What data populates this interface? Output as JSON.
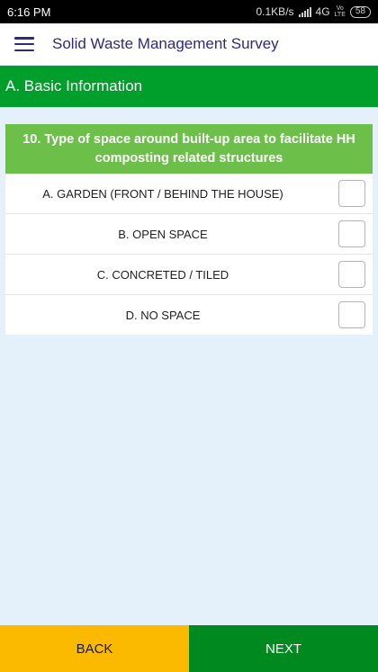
{
  "status_bar": {
    "time": "6:16 PM",
    "speed": "0.1KB/s",
    "network": "4G",
    "lte_top": "Vo",
    "lte_bottom": "LTE",
    "battery": "58"
  },
  "app_bar": {
    "title": "Solid Waste Management Survey"
  },
  "section": {
    "title": "A. Basic Information"
  },
  "question": {
    "title": "10. Type of space around built-up area to facilitate HH composting related structures",
    "options": [
      {
        "label": "A. GARDEN (FRONT / BEHIND THE HOUSE)",
        "checked": false
      },
      {
        "label": "B. OPEN SPACE",
        "checked": false
      },
      {
        "label": "C. CONCRETED / TILED",
        "checked": false
      },
      {
        "label": "D. NO SPACE",
        "checked": false
      }
    ]
  },
  "footer": {
    "back_label": "BACK",
    "next_label": "NEXT"
  },
  "colors": {
    "section_green": "#009e2a",
    "question_green": "#6cc04a",
    "back_yellow": "#fbb900",
    "next_green": "#00891f",
    "title_indigo": "#2d2a82",
    "background": "#e4f1fb"
  }
}
